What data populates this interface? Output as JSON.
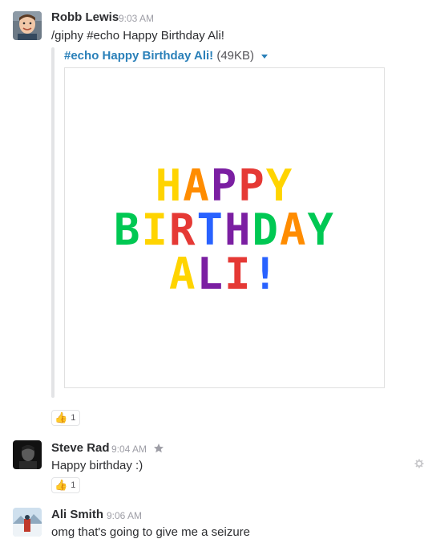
{
  "messages": [
    {
      "author": "Robb Lewis",
      "time": "9:03 AM",
      "text": "/giphy #echo Happy Birthday Ali!",
      "attachment": {
        "title": "#echo Happy Birthday Ali!",
        "size": "(49KB)",
        "gif_text": [
          "HAPPY",
          "BIRTHDAY",
          "ALI!"
        ]
      },
      "reaction": {
        "emoji": "thumbs-up-icon",
        "count": "1"
      }
    },
    {
      "author": "Steve Rad",
      "time": "9:04 AM",
      "text": "Happy birthday :)",
      "reaction": {
        "emoji": "thumbs-up-icon",
        "count": "1"
      }
    },
    {
      "author": "Ali Smith",
      "time": "9:06 AM",
      "text": "omg that's going to give me a seizure"
    }
  ],
  "colors": {
    "link": "#2a80b9",
    "timestamp": "#9e9ea6",
    "text": "#2c2d30",
    "rainbow": [
      "#ffd400",
      "#ff8c00",
      "#e53935",
      "#7b1fa2",
      "#2962ff",
      "#00c853"
    ]
  }
}
